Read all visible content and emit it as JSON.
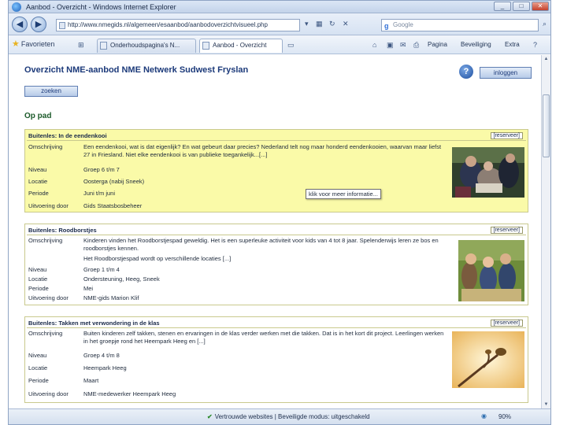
{
  "window": {
    "title": "Aanbod - Overzicht - Windows Internet Explorer"
  },
  "toolbar": {
    "address": "http://www.nmegids.nl/algemeen/esaanbod/aanbodoverzichtvisueel.php",
    "search_placeholder": "Google",
    "favorites_label": "Favorieten",
    "tabs": [
      "Onderhoudspagina's N...",
      "Aanbod - Overzicht"
    ],
    "page_menu": "Pagina",
    "safety_menu": "Beveiliging",
    "tools_menu": "Extra"
  },
  "page": {
    "title": "Overzicht NME-aanbod NME Netwerk Sudwest Fryslan",
    "help_label": "?",
    "login_label": "inloggen",
    "search_button": "zoeken",
    "section": "Op pad",
    "reserve_label": "[reserveer]",
    "tooltip": "klik voor meer informatie..."
  },
  "labels": {
    "description": "Omschrijving",
    "level": "Niveau",
    "location": "Locatie",
    "period": "Periode",
    "provider": "Uitvoering door"
  },
  "cards": [
    {
      "title": "Buitenles: In de eendenkooi",
      "description": "Een eendenkooi, wat is dat eigenlijk? En wat gebeurt daar precies? Nederland telt nog maar honderd eendenkooien, waarvan maar liefst 27 in Friesland. Niet elke eendenkooi is van publieke toegankelijk...[...]",
      "level": "Groep 6 t/m 7",
      "location": "Oosterga (nabij Sneek)",
      "period": "Juni t/m juni",
      "provider": "Gids Staatsbosbeheer"
    },
    {
      "title": "Buitenles: Roodborstjes",
      "description": "Kinderen vinden het Roodborstjespad geweldig. Het is een superleuke activiteit voor kids van 4 tot 8 jaar. Spelenderwijs leren ze bos en roodborstjes kennen.",
      "description2": "Het Roodborstjespad wordt op verschillende locaties [...]",
      "level": "Groep 1 t/m 4",
      "location": "Ondersteuning, Heeg, Sneek",
      "period": "Mei",
      "provider": "NME-gids Marion Klif"
    },
    {
      "title": "Buitenles: Takken met verwondering in de klas",
      "description": "Buiten kinderen zelf takken, stenen en ervaringen in de klas verder werken met die takken. Dat is in het kort dit project. Leerlingen werken in het groepje rond het Heempark Heeg en [...]",
      "level": "Groep 4 t/m 8",
      "location": "Heempark Heeg",
      "period": "Maart",
      "provider": "NME-medewerker Heempark Heeg"
    }
  ],
  "statusbar": {
    "text": "Vertrouwde websites | Beveiligde modus: uitgeschakeld",
    "zoom": "90%"
  },
  "colors": {
    "highlight_card": "#fafaa8",
    "accent": "#1c3a7a"
  }
}
